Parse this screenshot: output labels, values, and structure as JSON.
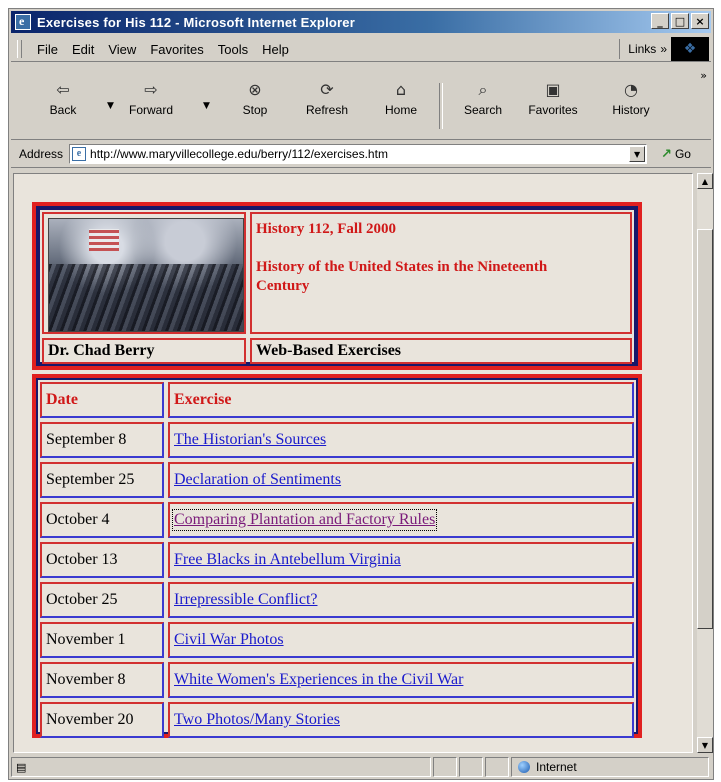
{
  "window": {
    "title": "Exercises for His 112 - Microsoft Internet Explorer",
    "controls": {
      "minimize": "_",
      "maximize": "□",
      "close": "×"
    }
  },
  "menu": {
    "items": [
      "File",
      "Edit",
      "View",
      "Favorites",
      "Tools",
      "Help"
    ],
    "links_label": "Links",
    "links_chevron": "»"
  },
  "toolbar": {
    "back": "Back",
    "forward": "Forward",
    "stop": "Stop",
    "refresh": "Refresh",
    "home": "Home",
    "search": "Search",
    "favorites": "Favorites",
    "history": "History",
    "more_chevron": "»"
  },
  "address": {
    "label": "Address",
    "url": "http://www.maryvillecollege.edu/berry/112/exercises.htm",
    "go_label": "Go"
  },
  "page": {
    "header": {
      "course": "History 112, Fall 2000",
      "course_title": "History of the United States in the Nineteenth Century",
      "instructor": "Dr. Chad Berry",
      "subtitle": "Web-Based Exercises"
    },
    "schedule": {
      "columns": [
        "Date",
        "Exercise"
      ],
      "rows": [
        {
          "date": "September 8",
          "exercise": "The Historian's Sources"
        },
        {
          "date": "September 25",
          "exercise": "Declaration of Sentiments"
        },
        {
          "date": "October 4",
          "exercise": "Comparing Plantation and Factory Rules"
        },
        {
          "date": "October 13",
          "exercise": "Free Blacks in Antebellum Virginia"
        },
        {
          "date": "October 25",
          "exercise": "Irrepressible Conflict?"
        },
        {
          "date": "November 1",
          "exercise": "Civil War Photos"
        },
        {
          "date": "November 8",
          "exercise": "White Women's Experiences in the Civil War"
        },
        {
          "date": "November 20",
          "exercise": "Two Photos/Many Stories"
        }
      ]
    }
  },
  "status": {
    "zone": "Internet"
  },
  "colors": {
    "table_border": "#e02020",
    "table_outer": "#18186a",
    "heading_text": "#d01818",
    "link": "#1a1acc",
    "visited_link": "#7a1a7a"
  }
}
